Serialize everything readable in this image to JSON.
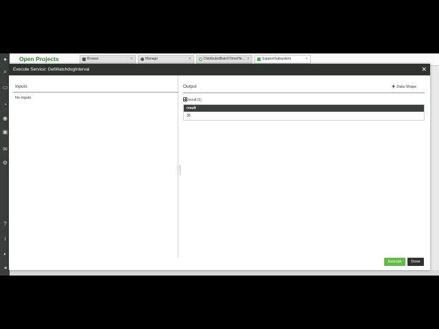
{
  "app": {
    "title": "Open Projects",
    "tabs": [
      {
        "label": "Browse",
        "icon": "folder-icon"
      },
      {
        "label": "Manage",
        "icon": "gear-icon"
      },
      {
        "label": "DistributedBatchTimerHe...",
        "icon": "thing-icon"
      },
      {
        "label": "SupportSubsystem",
        "icon": "subsystem-icon"
      }
    ]
  },
  "modal": {
    "title": "Execute Service: GetWatchdogInterval",
    "close_label": "✕",
    "inputs": {
      "title": "Inputs",
      "empty_text": "No inputs"
    },
    "output": {
      "title": "Output",
      "data_shape_label": "Data Shape",
      "result_caption": "result (1)",
      "columns": [
        "result"
      ],
      "rows": [
        [
          "30"
        ]
      ]
    },
    "buttons": {
      "execute": "Execute",
      "done": "Done"
    }
  },
  "colors": {
    "accent_green": "#66bb47",
    "header_dark": "#2f3330",
    "brand_green": "#2e7d32"
  }
}
